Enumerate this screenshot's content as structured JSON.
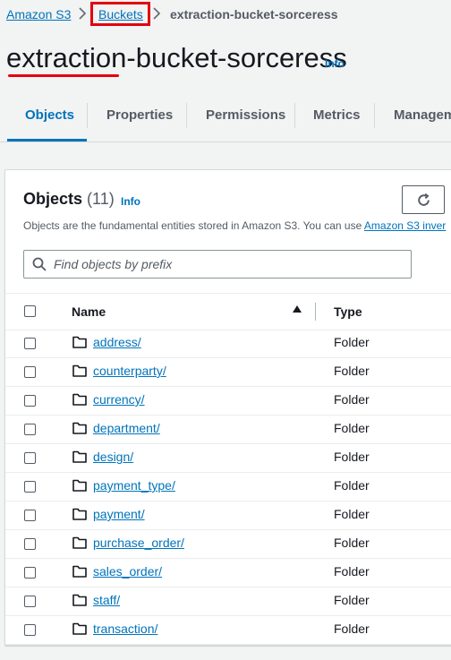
{
  "breadcrumb": {
    "items": [
      {
        "label": "Amazon S3"
      },
      {
        "label": "Buckets"
      },
      {
        "label": "extraction-bucket-sorceress"
      }
    ]
  },
  "page": {
    "title": "extraction-bucket-sorceress",
    "info": "Info"
  },
  "tabs": [
    {
      "label": "Objects",
      "active": true
    },
    {
      "label": "Properties"
    },
    {
      "label": "Permissions"
    },
    {
      "label": "Metrics"
    },
    {
      "label": "Managem"
    }
  ],
  "objects_panel": {
    "heading": "Objects",
    "count": "(11)",
    "info": "Info",
    "description": "Objects are the fundamental entities stored in Amazon S3. You can use",
    "description_link": "Amazon S3 inver",
    "search_placeholder": "Find objects by prefix",
    "columns": {
      "name": "Name",
      "type": "Type"
    },
    "rows": [
      {
        "name": "address/",
        "type": "Folder"
      },
      {
        "name": "counterparty/",
        "type": "Folder"
      },
      {
        "name": "currency/",
        "type": "Folder"
      },
      {
        "name": "department/",
        "type": "Folder"
      },
      {
        "name": "design/",
        "type": "Folder"
      },
      {
        "name": "payment_type/",
        "type": "Folder"
      },
      {
        "name": "payment/",
        "type": "Folder"
      },
      {
        "name": "purchase_order/",
        "type": "Folder"
      },
      {
        "name": "sales_order/",
        "type": "Folder"
      },
      {
        "name": "staff/",
        "type": "Folder"
      },
      {
        "name": "transaction/",
        "type": "Folder"
      }
    ]
  },
  "colors": {
    "link": "#0073bb",
    "annotation": "#e3000f",
    "text": "#16191f",
    "muted": "#545b64"
  },
  "icons": [
    "chevron-right-icon",
    "refresh-icon",
    "search-icon",
    "sort-ascending-icon",
    "folder-icon"
  ]
}
